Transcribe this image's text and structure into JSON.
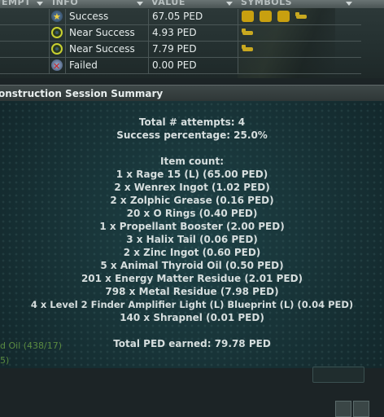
{
  "attempts_table": {
    "headers": [
      "EMPT",
      "INFO",
      "VALUE",
      "SYMBOLS"
    ],
    "rows": [
      {
        "icon": "success-star-icon",
        "info": "Success",
        "value": "67.05 PED",
        "symbols": [
          "gold-coin-icon",
          "blueprint-icon",
          "blueprint-icon",
          "animal-icon"
        ]
      },
      {
        "icon": "near-success-ring-icon",
        "info": "Near Success",
        "value": "4.93 PED",
        "symbols": [
          "animal-icon"
        ]
      },
      {
        "icon": "near-success-ring-icon",
        "info": "Near Success",
        "value": "7.79 PED",
        "symbols": [
          "animal-icon"
        ]
      },
      {
        "icon": "failed-x-icon",
        "info": "Failed",
        "value": "0.00 PED",
        "symbols": []
      }
    ]
  },
  "summary": {
    "title": "onstruction Session Summary",
    "total_attempts": "Total # attempts: 4",
    "success_percentage": "Success percentage: 25.0%",
    "item_count_label": "Item count:",
    "items": [
      "1 x Rage 15 (L) (65.00 PED)",
      "2 x Wenrex Ingot (1.02 PED)",
      "2 x Zolphic Grease (0.16 PED)",
      "20 x O Rings (0.40 PED)",
      "1 x Propellant Booster (2.00 PED)",
      "3 x Halix Tail (0.06 PED)",
      "2 x Zinc Ingot (0.60 PED)",
      "5 x Animal Thyroid Oil (0.50 PED)",
      "201 x Energy Matter Residue (2.01 PED)",
      "798 x Metal Residue (7.98 PED)",
      "4 x Level 2 Finder Amplifier Light (L) Blueprint (L) (0.04 PED)",
      "140 x Shrapnel (0.01 PED)"
    ],
    "total_earned": "Total PED earned: 79.78 PED"
  },
  "background": {
    "side_text_1": "d Oil (438/17)",
    "side_text_2": "5)"
  }
}
